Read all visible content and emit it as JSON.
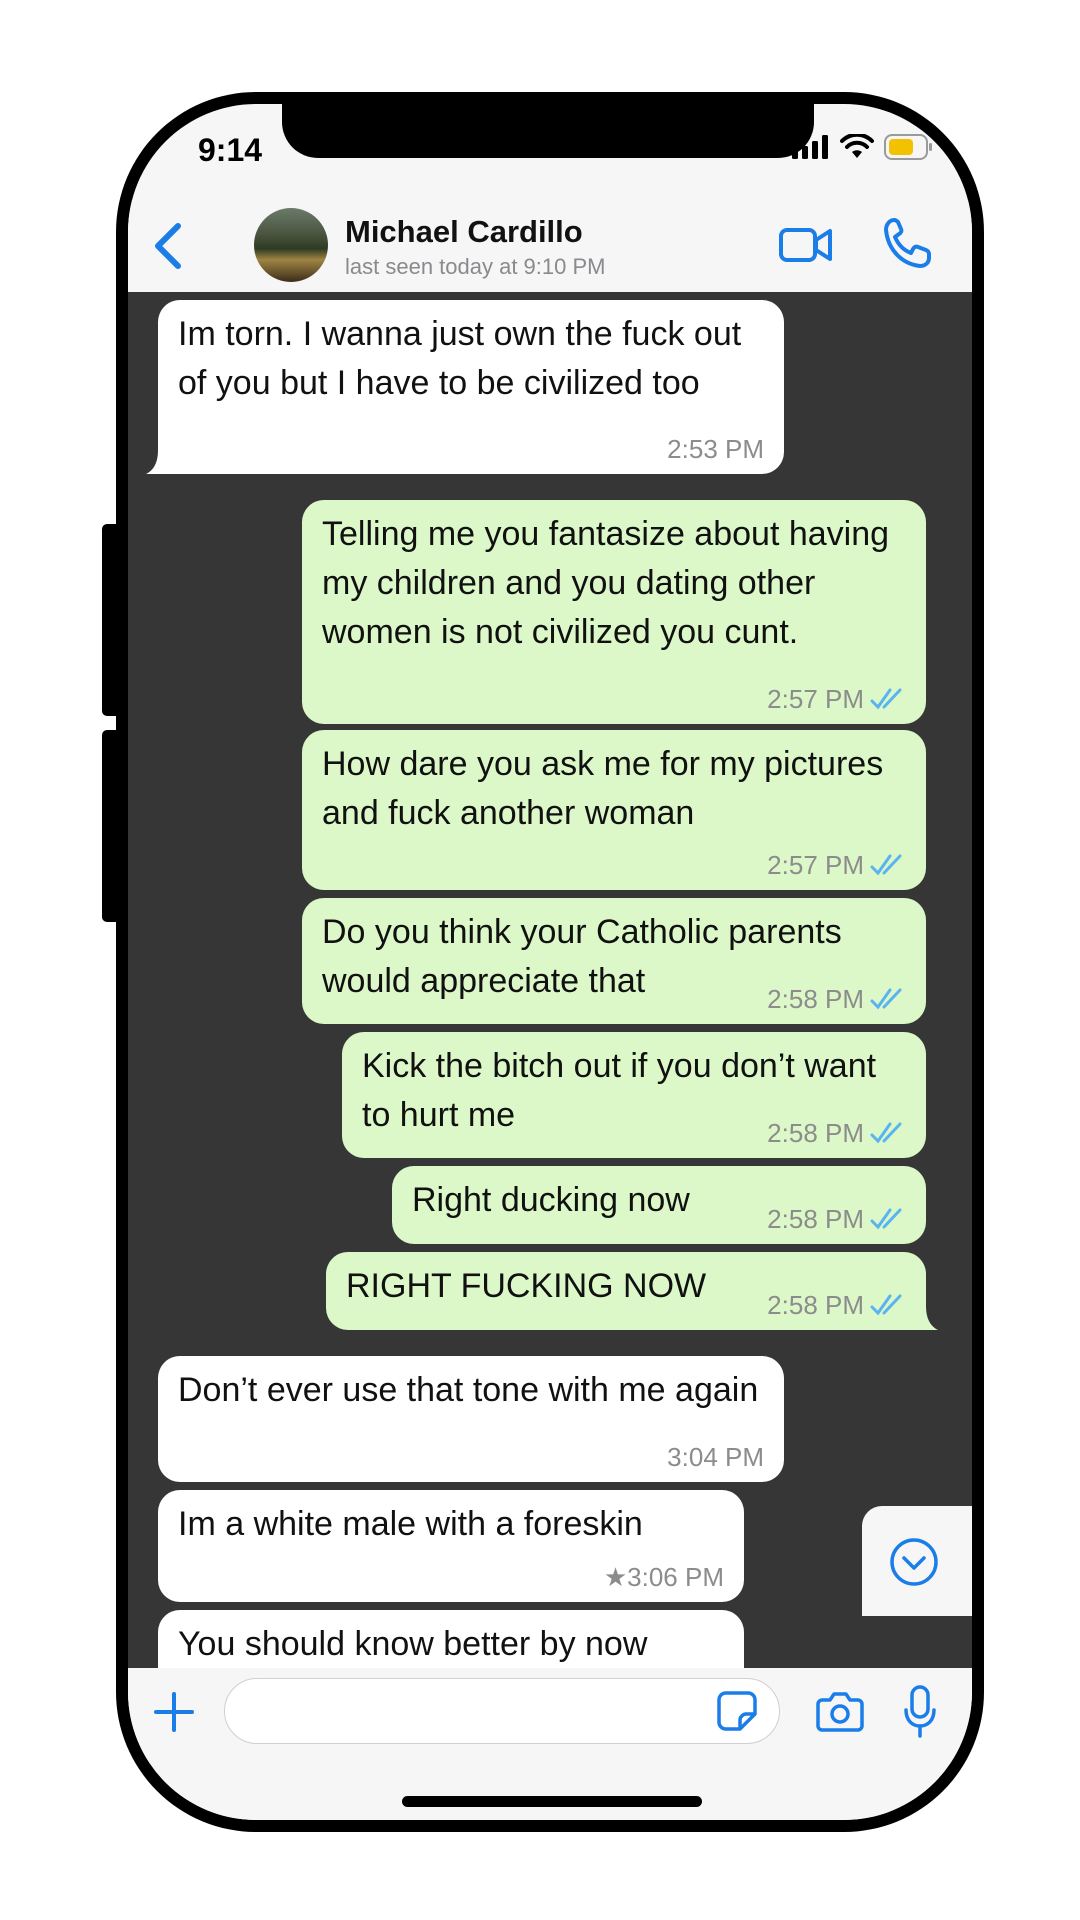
{
  "status_bar": {
    "time": "9:14"
  },
  "header": {
    "contact_name": "Michael Cardillo",
    "contact_status": "last seen today at 9:10 PM",
    "back_icon": "chevron-left-icon",
    "video_icon": "video-camera-icon",
    "call_icon": "phone-icon"
  },
  "messages": [
    {
      "direction": "in",
      "text": "Im torn. I wanna just own the fuck out of you but I have to be civilized too",
      "time": "2:53 PM",
      "starred": false,
      "read": false
    },
    {
      "direction": "out",
      "text": "Telling me you fantasize about having my children and you dating other women is not civilized you cunt.",
      "time": "2:57 PM",
      "read": true
    },
    {
      "direction": "out",
      "text": "How dare you ask me for my pictures and fuck another woman",
      "time": "2:57 PM",
      "read": true
    },
    {
      "direction": "out",
      "text": "Do you think your Catholic parents would appreciate that",
      "time": "2:58 PM",
      "read": true
    },
    {
      "direction": "out",
      "text": "Kick the bitch out if you don’t want to hurt me",
      "time": "2:58 PM",
      "read": true
    },
    {
      "direction": "out",
      "text": "Right ducking now",
      "time": "2:58 PM",
      "read": true
    },
    {
      "direction": "out",
      "text": "RIGHT FUCKING NOW",
      "time": "2:58 PM",
      "read": true
    },
    {
      "direction": "in",
      "text": "Don’t ever use that tone with me again",
      "time": "3:04 PM",
      "starred": false
    },
    {
      "direction": "in",
      "text": "Im a white male with a foreskin",
      "time": "★3:06 PM",
      "starred": true
    },
    {
      "direction": "in",
      "text": "You should know better by now",
      "time": "",
      "starred": false
    }
  ],
  "composer": {
    "placeholder": "",
    "value": ""
  },
  "colors": {
    "accent": "#1a7de8",
    "chat_background": "#363636",
    "incoming_bubble": "#ffffff",
    "outgoing_bubble": "#dcf8c8",
    "read_ticks": "#5ab4f0"
  }
}
